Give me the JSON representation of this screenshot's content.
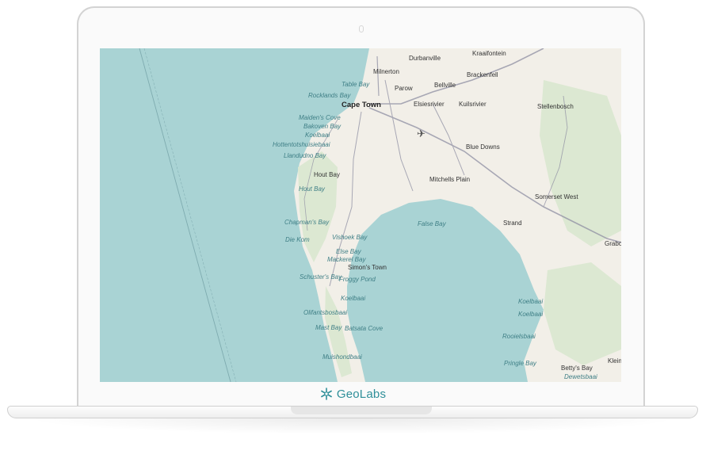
{
  "brand": {
    "name": "GeoLabs",
    "icon": "snowflake-logo-icon",
    "color": "#2f8f99"
  },
  "map": {
    "colors": {
      "water": "#a9d3d4",
      "land": "#f2efe8",
      "park": "#dce8d2",
      "road": "#8f8fa3"
    },
    "labels": [
      {
        "id": "durbanville",
        "text": "Durbanville",
        "kind": "town"
      },
      {
        "id": "kraaifontein",
        "text": "Kraaifontein",
        "kind": "town"
      },
      {
        "id": "milnerton",
        "text": "Milnerton",
        "kind": "town"
      },
      {
        "id": "brackenfell",
        "text": "Brackenfell",
        "kind": "town"
      },
      {
        "id": "table-bay",
        "text": "Table Bay",
        "kind": "bay"
      },
      {
        "id": "parow",
        "text": "Parow",
        "kind": "town"
      },
      {
        "id": "bellville",
        "text": "Bellville",
        "kind": "town"
      },
      {
        "id": "rocklands-bay",
        "text": "Rocklands Bay",
        "kind": "bay"
      },
      {
        "id": "cape-town",
        "text": "Cape Town",
        "kind": "city"
      },
      {
        "id": "elsiesrivier",
        "text": "Elsiesrivier",
        "kind": "town"
      },
      {
        "id": "kuilsrivier",
        "text": "Kuilsrivier",
        "kind": "town"
      },
      {
        "id": "stellenbosch",
        "text": "Stellenbosch",
        "kind": "town"
      },
      {
        "id": "maidens-cove",
        "text": "Maiden's Cove",
        "kind": "bay"
      },
      {
        "id": "bakoven-bay",
        "text": "Bakoven Bay",
        "kind": "bay"
      },
      {
        "id": "koelbaai-1",
        "text": "Koelbaai",
        "kind": "bay"
      },
      {
        "id": "hottentotshuisiebaai",
        "text": "Hottentotshuisiebaai",
        "kind": "bay"
      },
      {
        "id": "blue-downs",
        "text": "Blue Downs",
        "kind": "town"
      },
      {
        "id": "llandudno-bay",
        "text": "Llandudno Bay",
        "kind": "bay"
      },
      {
        "id": "hout-bay-town",
        "text": "Hout Bay",
        "kind": "town"
      },
      {
        "id": "mitchells-plain",
        "text": "Mitchells Plain",
        "kind": "town"
      },
      {
        "id": "hout-bay",
        "text": "Hout Bay",
        "kind": "bay"
      },
      {
        "id": "somerset-west",
        "text": "Somerset West",
        "kind": "town"
      },
      {
        "id": "false-bay",
        "text": "False Bay",
        "kind": "bay"
      },
      {
        "id": "strand",
        "text": "Strand",
        "kind": "town"
      },
      {
        "id": "chapmans-bay",
        "text": "Chapman's Bay",
        "kind": "bay"
      },
      {
        "id": "gordons-bay",
        "text": "Grabo",
        "kind": "town"
      },
      {
        "id": "vishoek-bay",
        "text": "Vishoek Bay",
        "kind": "bay"
      },
      {
        "id": "die-kom",
        "text": "Die Kom",
        "kind": "bay"
      },
      {
        "id": "else-bay",
        "text": "Else Bay",
        "kind": "bay"
      },
      {
        "id": "mackerel-bay",
        "text": "Mackerel Bay",
        "kind": "bay"
      },
      {
        "id": "simons-town",
        "text": "Simon's Town",
        "kind": "town"
      },
      {
        "id": "schusters-bay",
        "text": "Schuster's Bay",
        "kind": "bay"
      },
      {
        "id": "froggy-pond",
        "text": "Froggy Pond",
        "kind": "bay"
      },
      {
        "id": "koelbaai-2",
        "text": "Koelbaai",
        "kind": "bay"
      },
      {
        "id": "koelbaai-3",
        "text": "Koelbaai",
        "kind": "bay"
      },
      {
        "id": "koelbaai-4",
        "text": "Koelbaai",
        "kind": "bay"
      },
      {
        "id": "olifantsbosbaai",
        "text": "Olifantsbosbaai",
        "kind": "bay"
      },
      {
        "id": "mast-bay",
        "text": "Mast Bay",
        "kind": "bay"
      },
      {
        "id": "batsata-cove",
        "text": "Batsata Cove",
        "kind": "bay"
      },
      {
        "id": "rooielsbaai",
        "text": "Rooielsbaai",
        "kind": "bay"
      },
      {
        "id": "muishondbaai",
        "text": "Muishondbaai",
        "kind": "bay"
      },
      {
        "id": "pringle-bay",
        "text": "Pringle Bay",
        "kind": "bay"
      },
      {
        "id": "bettys-bay",
        "text": "Betty's Bay",
        "kind": "town"
      },
      {
        "id": "kleinmond",
        "text": "Klein",
        "kind": "town"
      },
      {
        "id": "dewetsbaai",
        "text": "Dewetsbaai",
        "kind": "bay"
      }
    ]
  }
}
